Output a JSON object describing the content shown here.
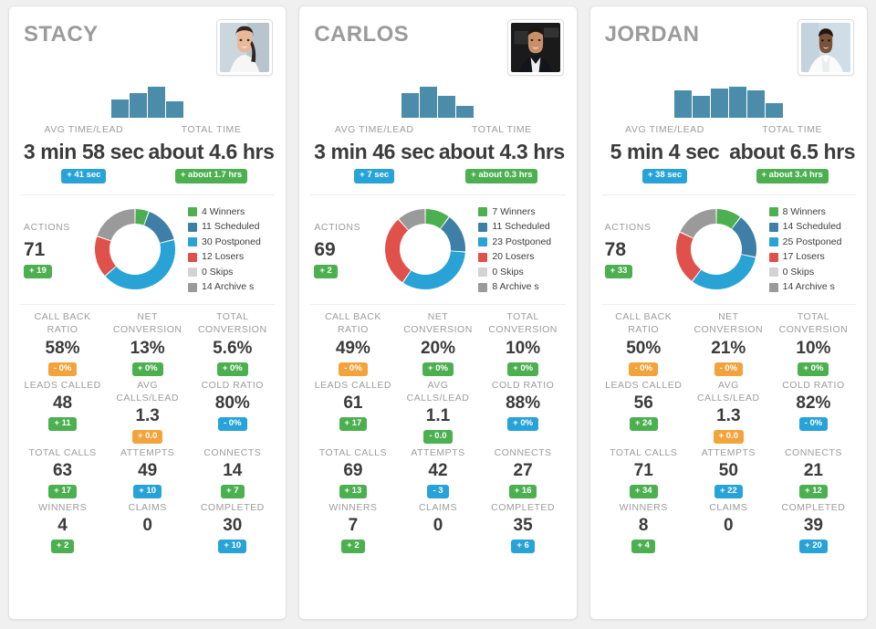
{
  "colors": {
    "green": "#4cb050",
    "blue": "#27a3d8",
    "orange": "#f2a33c",
    "red": "#e0514b",
    "steel_blue": "#3d7fa6",
    "light_blue": "#29a3d6",
    "light_gray": "#d3d3d3",
    "dark_gray": "#9a9a9a",
    "spark_bar": "#4b8cab",
    "card_bg": "#ffffff",
    "page_bg": "#f0f0f0",
    "label_gray": "#9c9c9c",
    "value_dark": "#3b3b3b"
  },
  "labels": {
    "avg_time_lead": "AVG TIME/LEAD",
    "total_time": "TOTAL TIME",
    "actions": "ACTIONS",
    "call_back_ratio": "CALL BACK RATIO",
    "net_conversion": "NET CONVERSION",
    "total_conversion": "TOTAL CONVERSION",
    "leads_called": "LEADS CALLED",
    "avg_calls_lead": "AVG CALLS/LEAD",
    "cold_ratio": "COLD RATIO",
    "total_calls": "TOTAL CALLS",
    "attempts": "ATTEMPTS",
    "connects": "CONNECTS",
    "winners": "WINNERS",
    "claims": "CLAIMS",
    "completed": "COMPLETED"
  },
  "cards": [
    {
      "name": "STACY",
      "avatar": "photo-woman-smiling",
      "sparkline": [
        60,
        78,
        100,
        52
      ],
      "avg_time_lead": {
        "value": "3 min 58 sec",
        "badge": "+ 41 sec",
        "badge_color": "blue"
      },
      "total_time": {
        "value": "about 4.6 hrs",
        "badge": "+ about 1.7 hrs",
        "badge_color": "green"
      },
      "actions": {
        "value": "71",
        "badge": "+ 19",
        "badge_color": "green"
      },
      "donut": [
        {
          "label": "4 Winners",
          "count": 4,
          "color": "#4cb050"
        },
        {
          "label": "11 Scheduled",
          "count": 11,
          "color": "#3d7fa6"
        },
        {
          "label": "30 Postponed",
          "count": 30,
          "color": "#29a3d6"
        },
        {
          "label": "12 Losers",
          "count": 12,
          "color": "#e0514b"
        },
        {
          "label": "0 Skips",
          "count": 0,
          "color": "#d3d3d3"
        },
        {
          "label": "14 Archive s",
          "count": 14,
          "color": "#9a9a9a"
        }
      ],
      "metrics": [
        {
          "key": "call_back_ratio",
          "value": "58%",
          "badge": "- 0%",
          "badge_color": "orange"
        },
        {
          "key": "net_conversion",
          "value": "13%",
          "badge": "+ 0%",
          "badge_color": "green"
        },
        {
          "key": "total_conversion",
          "value": "5.6%",
          "badge": "+ 0%",
          "badge_color": "green"
        },
        {
          "key": "leads_called",
          "value": "48",
          "badge": "+ 11",
          "badge_color": "green"
        },
        {
          "key": "avg_calls_lead",
          "value": "1.3",
          "badge": "+ 0.0",
          "badge_color": "orange"
        },
        {
          "key": "cold_ratio",
          "value": "80%",
          "badge": "- 0%",
          "badge_color": "blue"
        },
        {
          "key": "total_calls",
          "value": "63",
          "badge": "+ 17",
          "badge_color": "green"
        },
        {
          "key": "attempts",
          "value": "49",
          "badge": "+ 10",
          "badge_color": "blue"
        },
        {
          "key": "connects",
          "value": "14",
          "badge": "+ 7",
          "badge_color": "green"
        },
        {
          "key": "winners",
          "value": "4",
          "badge": "+ 2",
          "badge_color": "green"
        },
        {
          "key": "claims",
          "value": "0",
          "badge": "",
          "badge_color": "empty"
        },
        {
          "key": "completed",
          "value": "30",
          "badge": "+ 10",
          "badge_color": "blue"
        }
      ]
    },
    {
      "name": "CARLOS",
      "avatar": "photo-man-dark-suit",
      "sparkline": [
        78,
        100,
        72,
        38
      ],
      "avg_time_lead": {
        "value": "3 min 46 sec",
        "badge": "+ 7 sec",
        "badge_color": "blue"
      },
      "total_time": {
        "value": "about 4.3 hrs",
        "badge": "+ about 0.3 hrs",
        "badge_color": "green"
      },
      "actions": {
        "value": "69",
        "badge": "+ 2",
        "badge_color": "green"
      },
      "donut": [
        {
          "label": "7 Winners",
          "count": 7,
          "color": "#4cb050"
        },
        {
          "label": "11 Scheduled",
          "count": 11,
          "color": "#3d7fa6"
        },
        {
          "label": "23 Postponed",
          "count": 23,
          "color": "#29a3d6"
        },
        {
          "label": "20 Losers",
          "count": 20,
          "color": "#e0514b"
        },
        {
          "label": "0 Skips",
          "count": 0,
          "color": "#d3d3d3"
        },
        {
          "label": "8 Archive s",
          "count": 8,
          "color": "#9a9a9a"
        }
      ],
      "metrics": [
        {
          "key": "call_back_ratio",
          "value": "49%",
          "badge": "- 0%",
          "badge_color": "orange"
        },
        {
          "key": "net_conversion",
          "value": "20%",
          "badge": "+ 0%",
          "badge_color": "green"
        },
        {
          "key": "total_conversion",
          "value": "10%",
          "badge": "+ 0%",
          "badge_color": "green"
        },
        {
          "key": "leads_called",
          "value": "61",
          "badge": "+ 17",
          "badge_color": "green"
        },
        {
          "key": "avg_calls_lead",
          "value": "1.1",
          "badge": "- 0.0",
          "badge_color": "green"
        },
        {
          "key": "cold_ratio",
          "value": "88%",
          "badge": "+ 0%",
          "badge_color": "blue"
        },
        {
          "key": "total_calls",
          "value": "69",
          "badge": "+ 13",
          "badge_color": "green"
        },
        {
          "key": "attempts",
          "value": "42",
          "badge": "- 3",
          "badge_color": "blue"
        },
        {
          "key": "connects",
          "value": "27",
          "badge": "+ 16",
          "badge_color": "green"
        },
        {
          "key": "winners",
          "value": "7",
          "badge": "+ 2",
          "badge_color": "green"
        },
        {
          "key": "claims",
          "value": "0",
          "badge": "",
          "badge_color": "empty"
        },
        {
          "key": "completed",
          "value": "35",
          "badge": "+ 6",
          "badge_color": "blue"
        }
      ]
    },
    {
      "name": "JORDAN",
      "avatar": "photo-man-white-shirt",
      "sparkline": [
        88,
        70,
        95,
        100,
        88,
        48
      ],
      "avg_time_lead": {
        "value": "5 min 4 sec",
        "badge": "+ 38 sec",
        "badge_color": "blue"
      },
      "total_time": {
        "value": "about 6.5 hrs",
        "badge": "+ about 3.4 hrs",
        "badge_color": "green"
      },
      "actions": {
        "value": "78",
        "badge": "+ 33",
        "badge_color": "green"
      },
      "donut": [
        {
          "label": "8 Winners",
          "count": 8,
          "color": "#4cb050"
        },
        {
          "label": "14 Scheduled",
          "count": 14,
          "color": "#3d7fa6"
        },
        {
          "label": "25 Postponed",
          "count": 25,
          "color": "#29a3d6"
        },
        {
          "label": "17 Losers",
          "count": 17,
          "color": "#e0514b"
        },
        {
          "label": "0 Skips",
          "count": 0,
          "color": "#d3d3d3"
        },
        {
          "label": "14 Archive s",
          "count": 14,
          "color": "#9a9a9a"
        }
      ],
      "metrics": [
        {
          "key": "call_back_ratio",
          "value": "50%",
          "badge": "- 0%",
          "badge_color": "orange"
        },
        {
          "key": "net_conversion",
          "value": "21%",
          "badge": "- 0%",
          "badge_color": "orange"
        },
        {
          "key": "total_conversion",
          "value": "10%",
          "badge": "+ 0%",
          "badge_color": "green"
        },
        {
          "key": "leads_called",
          "value": "56",
          "badge": "+ 24",
          "badge_color": "green"
        },
        {
          "key": "avg_calls_lead",
          "value": "1.3",
          "badge": "+ 0.0",
          "badge_color": "orange"
        },
        {
          "key": "cold_ratio",
          "value": "82%",
          "badge": "- 0%",
          "badge_color": "blue"
        },
        {
          "key": "total_calls",
          "value": "71",
          "badge": "+ 34",
          "badge_color": "green"
        },
        {
          "key": "attempts",
          "value": "50",
          "badge": "+ 22",
          "badge_color": "blue"
        },
        {
          "key": "connects",
          "value": "21",
          "badge": "+ 12",
          "badge_color": "green"
        },
        {
          "key": "winners",
          "value": "8",
          "badge": "+ 4",
          "badge_color": "green"
        },
        {
          "key": "claims",
          "value": "0",
          "badge": "",
          "badge_color": "empty"
        },
        {
          "key": "completed",
          "value": "39",
          "badge": "+ 20",
          "badge_color": "blue"
        }
      ]
    }
  ],
  "chart_data": [
    {
      "type": "pie",
      "title": "STACY Actions Breakdown",
      "labels": [
        "Winners",
        "Scheduled",
        "Postponed",
        "Losers",
        "Skips",
        "Archive s"
      ],
      "values": [
        4,
        11,
        30,
        12,
        0,
        14
      ],
      "total": 71,
      "legend": "right"
    },
    {
      "type": "pie",
      "title": "CARLOS Actions Breakdown",
      "labels": [
        "Winners",
        "Scheduled",
        "Postponed",
        "Losers",
        "Skips",
        "Archive s"
      ],
      "values": [
        7,
        11,
        23,
        20,
        0,
        8
      ],
      "total": 69,
      "legend": "right"
    },
    {
      "type": "pie",
      "title": "JORDAN Actions Breakdown",
      "labels": [
        "Winners",
        "Scheduled",
        "Postponed",
        "Losers",
        "Skips",
        "Archive s"
      ],
      "values": [
        8,
        14,
        25,
        17,
        0,
        14
      ],
      "total": 78,
      "legend": "right"
    },
    {
      "type": "bar",
      "title": "STACY Activity Sparkline",
      "categories": [
        "1",
        "2",
        "3",
        "4"
      ],
      "values": [
        60,
        78,
        100,
        52
      ]
    },
    {
      "type": "bar",
      "title": "CARLOS Activity Sparkline",
      "categories": [
        "1",
        "2",
        "3",
        "4"
      ],
      "values": [
        78,
        100,
        72,
        38
      ]
    },
    {
      "type": "bar",
      "title": "JORDAN Activity Sparkline",
      "categories": [
        "1",
        "2",
        "3",
        "4",
        "5",
        "6"
      ],
      "values": [
        88,
        70,
        95,
        100,
        88,
        48
      ]
    }
  ]
}
